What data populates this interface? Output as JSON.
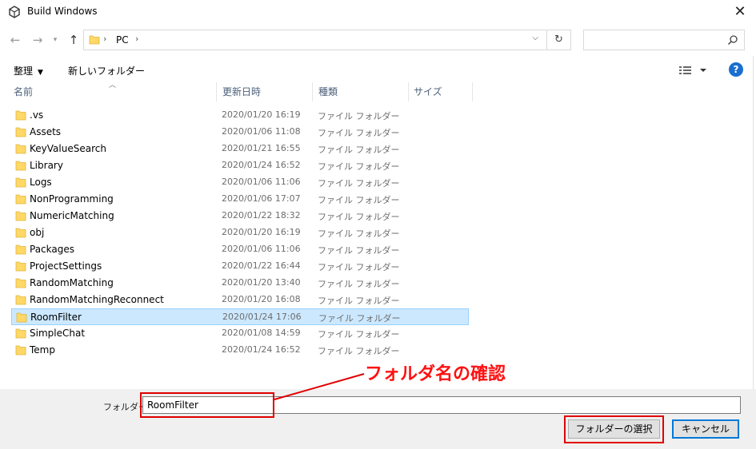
{
  "window": {
    "title": "Build Windows"
  },
  "nav": {
    "back_icon": "arrow-left-icon",
    "forward_icon": "arrow-right-icon",
    "up_icon": "arrow-up-icon",
    "breadcrumb": "PC",
    "search_placeholder": ""
  },
  "toolbar": {
    "organize": "整理",
    "new_folder": "新しいフォルダー"
  },
  "columns": {
    "name": "名前",
    "date": "更新日時",
    "type": "種類",
    "size": "サイズ"
  },
  "files": [
    {
      "name": ".vs",
      "date": "2020/01/20 16:19",
      "type": "ファイル フォルダー"
    },
    {
      "name": "Assets",
      "date": "2020/01/06 11:08",
      "type": "ファイル フォルダー"
    },
    {
      "name": "KeyValueSearch",
      "date": "2020/01/21 16:55",
      "type": "ファイル フォルダー"
    },
    {
      "name": "Library",
      "date": "2020/01/24 16:52",
      "type": "ファイル フォルダー"
    },
    {
      "name": "Logs",
      "date": "2020/01/06 11:06",
      "type": "ファイル フォルダー"
    },
    {
      "name": "NonProgramming",
      "date": "2020/01/06 17:07",
      "type": "ファイル フォルダー"
    },
    {
      "name": "NumericMatching",
      "date": "2020/01/22 18:32",
      "type": "ファイル フォルダー"
    },
    {
      "name": "obj",
      "date": "2020/01/20 16:19",
      "type": "ファイル フォルダー"
    },
    {
      "name": "Packages",
      "date": "2020/01/06 11:06",
      "type": "ファイル フォルダー"
    },
    {
      "name": "ProjectSettings",
      "date": "2020/01/22 16:44",
      "type": "ファイル フォルダー"
    },
    {
      "name": "RandomMatching",
      "date": "2020/01/20 13:40",
      "type": "ファイル フォルダー"
    },
    {
      "name": "RandomMatchingReconnect",
      "date": "2020/01/20 16:08",
      "type": "ファイル フォルダー"
    },
    {
      "name": "RoomFilter",
      "date": "2020/01/24 17:06",
      "type": "ファイル フォルダー"
    },
    {
      "name": "SimpleChat",
      "date": "2020/01/08 14:59",
      "type": "ファイル フォルダー"
    },
    {
      "name": "Temp",
      "date": "2020/01/24 16:52",
      "type": "ファイル フォルダー"
    }
  ],
  "selected_index": 12,
  "footer": {
    "folder_label": "フォルダー:",
    "folder_value": "RoomFilter",
    "select_button": "フォルダーの選択",
    "cancel_button": "キャンセル"
  },
  "annotation": {
    "text": "フォルダ名の確認",
    "color": "#ff1010"
  },
  "colors": {
    "accent": "#0078d7",
    "selection": "#cce8ff",
    "folder": "#ffd867",
    "help": "#1a6fd0"
  }
}
